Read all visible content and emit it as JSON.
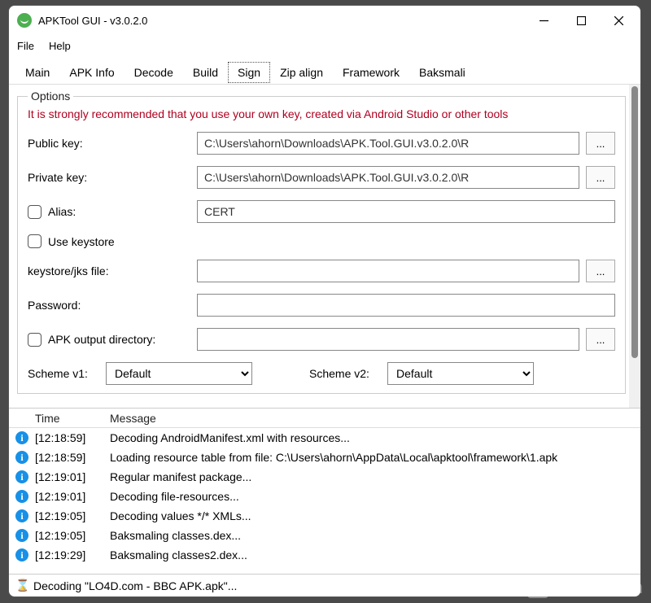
{
  "window": {
    "title": "APKTool GUI - v3.0.2.0"
  },
  "menu": {
    "file": "File",
    "help": "Help"
  },
  "tabs": {
    "items": [
      "Main",
      "APK Info",
      "Decode",
      "Build",
      "Sign",
      "Zip align",
      "Framework",
      "Baksmali"
    ],
    "selected_index": 4
  },
  "options": {
    "legend": "Options",
    "warning": "It is strongly recommended that you use your own key, created via Android Studio or other tools",
    "public_key_label": "Public key:",
    "public_key_value": "C:\\Users\\ahorn\\Downloads\\APK.Tool.GUI.v3.0.2.0\\R",
    "private_key_label": "Private key:",
    "private_key_value": "C:\\Users\\ahorn\\Downloads\\APK.Tool.GUI.v3.0.2.0\\R",
    "alias_label": "Alias:",
    "alias_value": "CERT",
    "use_keystore_label": "Use keystore",
    "keystore_label": "keystore/jks file:",
    "keystore_value": "",
    "password_label": "Password:",
    "password_value": "",
    "apk_output_label": "APK output directory:",
    "apk_output_value": "",
    "browse_label": "...",
    "scheme1_label": "Scheme v1:",
    "scheme1_value": "Default",
    "scheme2_label": "Scheme v2:",
    "scheme2_value": "Default"
  },
  "log": {
    "header_time": "Time",
    "header_message": "Message",
    "rows": [
      {
        "time": "[12:18:59]",
        "msg": "Decoding AndroidManifest.xml with resources..."
      },
      {
        "time": "[12:18:59]",
        "msg": "Loading resource table from file: C:\\Users\\ahorn\\AppData\\Local\\apktool\\framework\\1.apk"
      },
      {
        "time": "[12:19:01]",
        "msg": "Regular manifest package..."
      },
      {
        "time": "[12:19:01]",
        "msg": "Decoding file-resources..."
      },
      {
        "time": "[12:19:05]",
        "msg": "Decoding values */* XMLs..."
      },
      {
        "time": "[12:19:05]",
        "msg": "Baksmaling classes.dex..."
      },
      {
        "time": "[12:19:29]",
        "msg": "Baksmaling classes2.dex..."
      }
    ]
  },
  "status": {
    "text": "Decoding \"LO4D.com - BBC APK.apk\"..."
  },
  "watermark": {
    "text": "LO4D.com"
  }
}
